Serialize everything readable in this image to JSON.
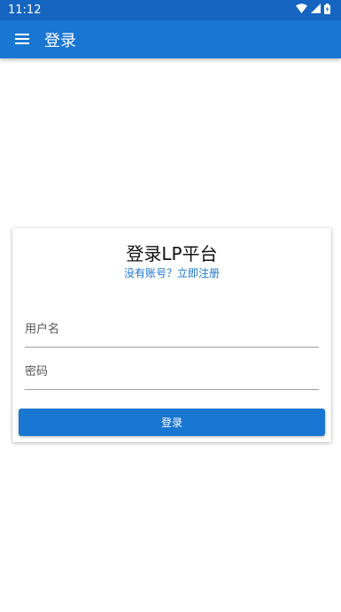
{
  "status_bar": {
    "time": "11:12",
    "wifi_icon": "wifi-icon",
    "signal_icon": "signal-icon",
    "battery_icon": "battery-icon"
  },
  "app_bar": {
    "title": "登录",
    "menu_icon": "menu-icon"
  },
  "login_card": {
    "title": "登录LP平台",
    "register_link": "没有账号？立即注册",
    "username_placeholder": "用户名",
    "password_placeholder": "密码",
    "submit_label": "登录"
  },
  "colors": {
    "primary": "#1976d2",
    "status_bar": "#1565c0"
  }
}
